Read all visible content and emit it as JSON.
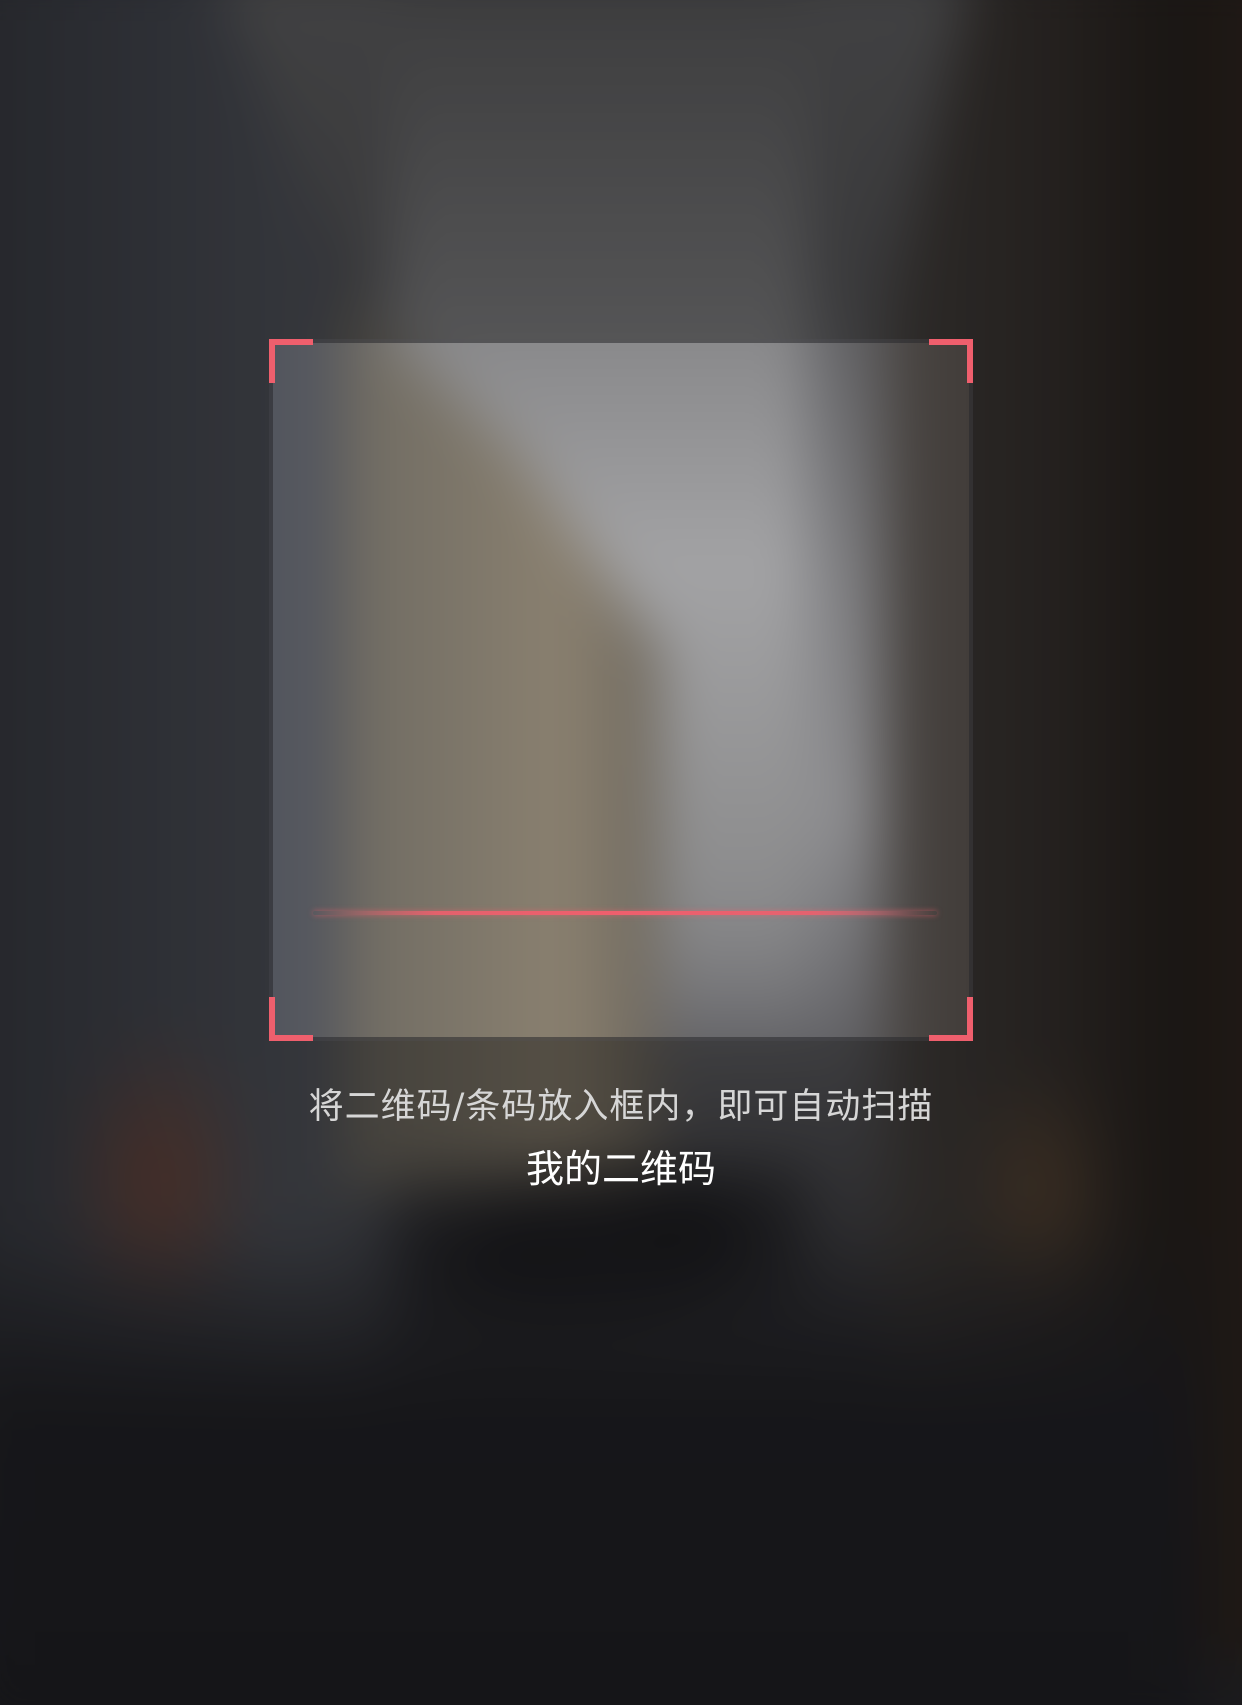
{
  "scanner": {
    "hint": "将二维码/条码放入框内，即可自动扫描",
    "my_qrcode_label": "我的二维码",
    "accent_color": "#ef5f6d"
  }
}
